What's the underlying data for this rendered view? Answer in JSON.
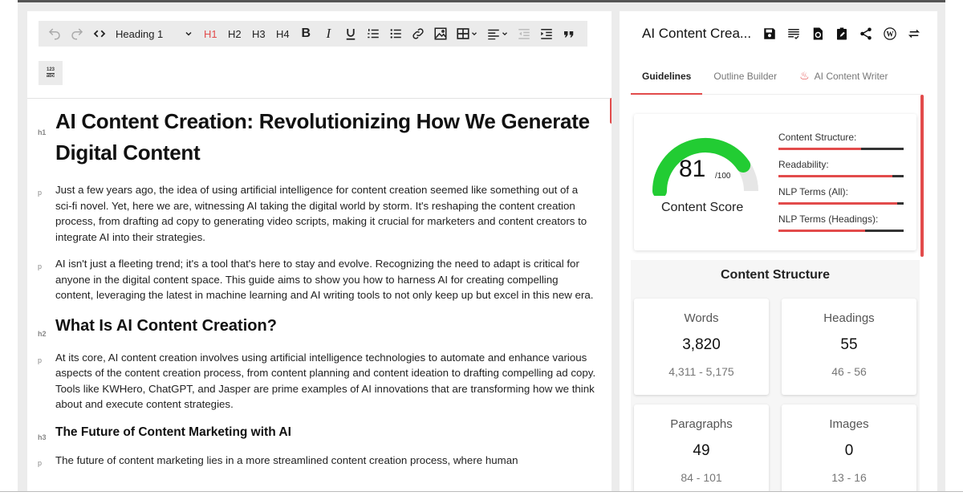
{
  "toolbar": {
    "heading_select": "Heading 1",
    "headings": [
      "H1",
      "H2",
      "H3",
      "H4"
    ],
    "active_heading": "H1",
    "spellcheck_top": "123",
    "spellcheck_bottom": "abc"
  },
  "document": {
    "blocks": [
      {
        "tag": "h1",
        "text": "AI Content Creation: Revolutionizing How We Generate Digital Content"
      },
      {
        "tag": "p",
        "text": "Just a few years ago, the idea of using artificial intelligence for content creation seemed like something out of a sci-fi novel. Yet, here we are, witnessing AI taking the digital world by storm. It's reshaping the content creation process, from drafting ad copy to generating video scripts, making it crucial for marketers and content creators to integrate AI into their strategies."
      },
      {
        "tag": "p",
        "text": "AI isn't just a fleeting trend; it's a tool that's here to stay and evolve. Recognizing the need to adapt is critical for anyone in the digital content space. This guide aims to show you how to harness AI for creating compelling content, leveraging the latest in machine learning and AI writing tools to not only keep up but excel in this new era."
      },
      {
        "tag": "h2",
        "text": "What Is AI Content Creation?"
      },
      {
        "tag": "p",
        "text": "At its core, AI content creation involves using artificial intelligence technologies to automate and enhance various aspects of the content creation process, from content planning and content ideation to drafting compelling ad copy. Tools like KWHero, ChatGPT, and Jasper are prime examples of AI innovations that are transforming how we think about and execute content strategies."
      },
      {
        "tag": "h3",
        "text": "The Future of Content Marketing with AI"
      },
      {
        "tag": "p",
        "text": "The future of content marketing lies in a more streamlined content creation process, where human"
      }
    ]
  },
  "side": {
    "title": "AI Content Crea...",
    "tabs": [
      {
        "label": "Guidelines",
        "active": true
      },
      {
        "label": "Outline Builder",
        "active": false
      },
      {
        "label": "AI Content Writer",
        "active": false
      }
    ],
    "score": {
      "value": "81",
      "max": "/100",
      "fraction": 0.81,
      "label": "Content Score",
      "color": "#22cc33"
    },
    "metrics": [
      {
        "label": "Content Structure:",
        "fill": 0.66
      },
      {
        "label": "Readability:",
        "fill": 0.91
      },
      {
        "label": "NLP Terms (All):",
        "fill": 0.95
      },
      {
        "label": "NLP Terms (Headings):",
        "fill": 0.69
      }
    ],
    "content_structure": {
      "title": "Content Structure",
      "stats": [
        {
          "name": "Words",
          "value": "3,820",
          "range": "4,311  - 5,175"
        },
        {
          "name": "Headings",
          "value": "55",
          "range": "46  - 56"
        },
        {
          "name": "Paragraphs",
          "value": "49",
          "range": "84  - 101"
        },
        {
          "name": "Images",
          "value": "0",
          "range": "13  - 16"
        }
      ]
    }
  },
  "colors": {
    "accent": "#e24b4b",
    "gauge": "#22cc33",
    "track": "#e6e6e6"
  }
}
